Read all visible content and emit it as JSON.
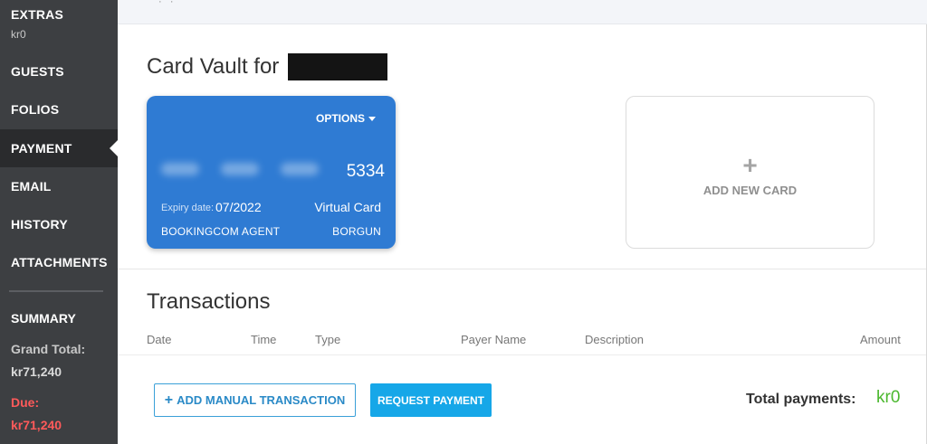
{
  "sidebar": {
    "extras": {
      "label": "EXTRAS",
      "amount": "kr0"
    },
    "items": [
      {
        "label": "GUESTS"
      },
      {
        "label": "FOLIOS"
      },
      {
        "label": "PAYMENT"
      },
      {
        "label": "EMAIL"
      },
      {
        "label": "HISTORY"
      },
      {
        "label": "ATTACHMENTS"
      }
    ],
    "active_item": "PAYMENT",
    "summary": {
      "title": "SUMMARY",
      "grand_total_label": "Grand Total:",
      "grand_total_value": "kr71,240",
      "due_label": "Due:",
      "due_value": "kr71,240"
    }
  },
  "vault": {
    "title": "Card Vault for",
    "card": {
      "options_label": "OPTIONS",
      "last4": "5334",
      "expiry_label": "Expiry date:",
      "expiry": "07/2022",
      "kind": "Virtual Card",
      "holder": "BOOKINGCOM AGENT",
      "processor": "BORGUN"
    },
    "add_card": {
      "plus": "+",
      "label": "ADD NEW CARD"
    }
  },
  "transactions": {
    "title": "Transactions",
    "columns": [
      "Date",
      "Time",
      "Type",
      "Payer Name",
      "Description",
      "Amount"
    ],
    "add_manual_label": "ADD MANUAL TRANSACTION",
    "add_manual_plus": "+",
    "request_payment_label": "REQUEST PAYMENT",
    "total_label": "Total payments:",
    "total_value": "kr0"
  },
  "colors": {
    "sidebar_bg": "#3d3f42",
    "card_blue": "#2f7bd3",
    "accent_blue": "#16a7e8",
    "due_red": "#ff5a5a",
    "total_green": "#4cb82f"
  }
}
